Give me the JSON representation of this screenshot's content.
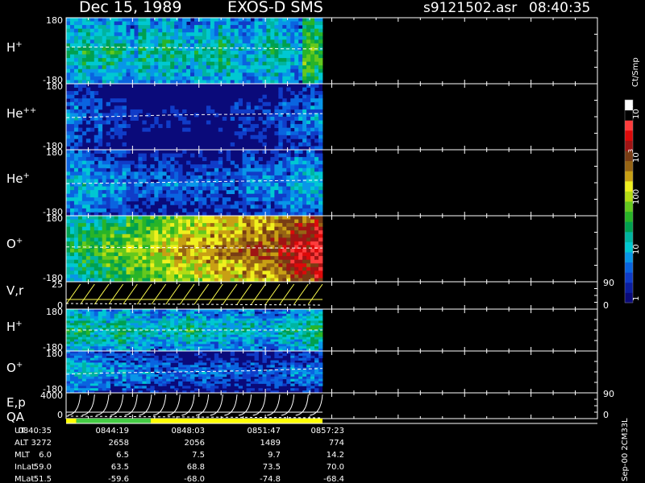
{
  "header": {
    "title": "Dec 15, 1989",
    "instrument": "EXOS-D SMS",
    "file": "s9121502.asr",
    "time": "08:40:35"
  },
  "colorbar": {
    "unit": "Ct/Smp",
    "tick_labels": [
      "1",
      "10",
      "100",
      "10",
      "3",
      "10",
      "4"
    ],
    "colors": [
      "#0a0a7a",
      "#0c1ea0",
      "#103cc8",
      "#0a64e0",
      "#0896e8",
      "#00c8d2",
      "#00b4a0",
      "#00a050",
      "#28b428",
      "#64c81e",
      "#b4dc14",
      "#f0f01e",
      "#c8a014",
      "#966414",
      "#783c14",
      "#a01414",
      "#dc0a0a",
      "#ff3c3c",
      "#000000",
      "#ffffff"
    ]
  },
  "chart_data": [
    {
      "type": "heatmap",
      "panel_label": "H+",
      "y_ticks": [
        "180",
        "-180"
      ],
      "ylim": [
        -180,
        180
      ],
      "trace": [
        20,
        20,
        17,
        17,
        14,
        14,
        10,
        10
      ],
      "level_profile": [
        6,
        7,
        6,
        7,
        6,
        5,
        7,
        6,
        7,
        6,
        5,
        6,
        6,
        7,
        6,
        5,
        6,
        7,
        6,
        5,
        9,
        8
      ]
    },
    {
      "type": "heatmap",
      "panel_label": "He++",
      "y_ticks": [
        "180",
        "-180"
      ],
      "ylim": [
        -180,
        180
      ],
      "trace": [
        -5,
        0,
        5,
        10,
        12,
        14,
        16,
        17
      ],
      "level_profile": [
        4,
        3,
        3,
        2,
        2,
        1,
        1,
        1,
        1,
        1,
        1,
        1,
        1,
        1,
        2,
        2,
        2,
        2,
        3,
        3,
        4,
        4
      ]
    },
    {
      "type": "heatmap",
      "panel_label": "He+",
      "y_ticks": [
        "180",
        "-180"
      ],
      "ylim": [
        -180,
        180
      ],
      "trace": [
        -5,
        -2,
        0,
        3,
        6,
        9,
        12,
        14
      ],
      "level_profile": [
        5,
        5,
        4,
        4,
        4,
        3,
        3,
        3,
        3,
        3,
        3,
        3,
        3,
        3,
        3,
        4,
        4,
        4,
        4,
        5,
        5,
        5
      ]
    },
    {
      "type": "heatmap",
      "panel_label": "O+",
      "y_ticks": [
        "180",
        "-180"
      ],
      "ylim": [
        -180,
        180
      ],
      "trace": [
        10,
        8,
        6,
        6,
        5,
        5,
        4,
        4
      ],
      "level_profile": [
        7,
        8,
        8,
        9,
        9,
        10,
        10,
        11,
        11,
        12,
        12,
        12,
        13,
        13,
        13,
        14,
        14,
        14,
        15,
        16,
        16,
        17
      ]
    },
    {
      "type": "line",
      "panel_label": "V,r",
      "y_ticks": [
        "25",
        "0"
      ],
      "right_ticks": [
        "90",
        "0"
      ],
      "ylim": [
        0,
        25
      ]
    },
    {
      "type": "heatmap",
      "panel_label": "H+",
      "y_ticks": [
        "180",
        "-180"
      ],
      "ylim": [
        -180,
        180
      ],
      "trace": [
        0,
        0,
        0,
        0,
        0,
        0,
        0,
        0
      ],
      "level_profile": [
        7,
        7,
        6,
        6,
        7,
        6,
        6,
        5,
        6,
        6,
        7,
        6,
        5,
        6,
        5,
        6,
        5,
        5,
        6,
        6,
        7,
        7
      ]
    },
    {
      "type": "heatmap",
      "panel_label": "O+",
      "y_ticks": [
        "180",
        "-180"
      ],
      "ylim": [
        -180,
        180
      ],
      "trace": [
        -20,
        -10,
        -5,
        0,
        5,
        10,
        20,
        30
      ],
      "level_profile": [
        5,
        5,
        5,
        4,
        4,
        4,
        4,
        3,
        3,
        3,
        3,
        3,
        3,
        3,
        3,
        3,
        3,
        3,
        3,
        4,
        4,
        4
      ]
    },
    {
      "type": "line",
      "panel_label": "E,p",
      "y_ticks": [
        "4000",
        "0"
      ],
      "right_ticks": [
        "90",
        "0"
      ],
      "ylim": [
        0,
        4000
      ]
    }
  ],
  "qa": {
    "label": "QA",
    "segments": [
      {
        "start": 0,
        "end": 0.04,
        "color": "#ffff00"
      },
      {
        "start": 0.04,
        "end": 0.33,
        "color": "#44cc44"
      },
      {
        "start": 0.33,
        "end": 1.0,
        "color": "#ffff00"
      }
    ]
  },
  "orbit_table": {
    "row_labels": [
      "UT",
      "ALT",
      "MLT",
      "InLat",
      "MLat"
    ],
    "columns": [
      {
        "values": [
          "0840:35",
          "3272",
          "6.0",
          "59.0",
          "-51.5"
        ]
      },
      {
        "values": [
          "0844:19",
          "2658",
          "6.5",
          "63.5",
          "-59.6"
        ]
      },
      {
        "values": [
          "0848:03",
          "2056",
          "7.5",
          "68.8",
          "-68.0"
        ]
      },
      {
        "values": [
          "0851:47",
          "1489",
          "9.7",
          "73.5",
          "-74.8"
        ]
      },
      {
        "values": [
          "0857:23",
          "774",
          "14.2",
          "70.0",
          "-68.4"
        ]
      }
    ]
  },
  "footer_stamp": "Sep-00 2CM33L"
}
